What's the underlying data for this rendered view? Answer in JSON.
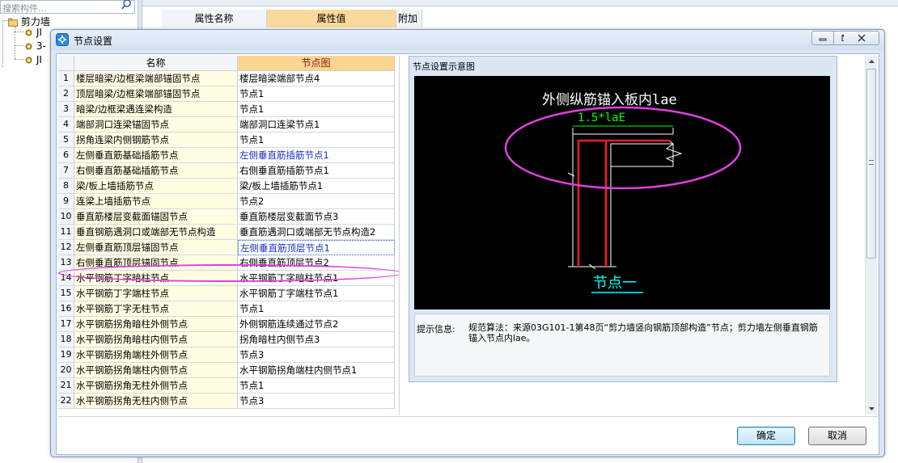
{
  "background": {
    "search_placeholder": "搜索构件...",
    "tree": {
      "root": "剪力墙",
      "children": [
        "JI",
        "3-",
        "JI"
      ]
    },
    "property_header": {
      "name_col": "属性名称",
      "value_col": "属性值",
      "extra_col": "附加"
    }
  },
  "dialog": {
    "title": "节点设置",
    "grid": {
      "headers": {
        "index": "",
        "name": "名称",
        "node": "节点图"
      },
      "rows": [
        {
          "idx": "1",
          "name": "楼层暗梁/边框梁端部锚固节点",
          "node": "楼层暗梁端部节点4"
        },
        {
          "idx": "2",
          "name": "顶层暗梁/边框梁端部锚固节点",
          "node": "节点1"
        },
        {
          "idx": "3",
          "name": "暗梁/边框梁遇连梁构造",
          "node": "节点1"
        },
        {
          "idx": "4",
          "name": "端部洞口连梁锚固节点",
          "node": "端部洞口连梁节点1"
        },
        {
          "idx": "5",
          "name": "拐角连梁内侧钢筋节点",
          "node": "节点1"
        },
        {
          "idx": "6",
          "name": "左侧垂直筋基础插筋节点",
          "node": "左侧垂直筋插筋节点1"
        },
        {
          "idx": "7",
          "name": "右侧垂直筋基础插筋节点",
          "node": "右侧垂直筋插筋节点1"
        },
        {
          "idx": "8",
          "name": "梁/板上墙插筋节点",
          "node": "梁/板上墙插筋节点1"
        },
        {
          "idx": "9",
          "name": "连梁上墙插筋节点",
          "node": "节点2"
        },
        {
          "idx": "10",
          "name": "垂直筋楼层变截面锚固节点",
          "node": "垂直筋楼层变截面节点3"
        },
        {
          "idx": "11",
          "name": "垂直钢筋遇洞口或端部无节点构造",
          "node": "垂直筋遇洞口或端部无节点构造2"
        },
        {
          "idx": "12",
          "name": "左侧垂直筋顶层锚固节点",
          "node": "左侧垂直筋顶层节点1"
        },
        {
          "idx": "13",
          "name": "右侧垂直筋顶层锚固节点",
          "node": "右侧垂直筋顶层节点2"
        },
        {
          "idx": "14",
          "name": "水平钢筋丁字暗柱节点",
          "node": "水平钢筋丁字暗柱节点1"
        },
        {
          "idx": "15",
          "name": "水平钢筋丁字端柱节点",
          "node": "水平钢筋丁字端柱节点1"
        },
        {
          "idx": "16",
          "name": "水平钢筋丁字无柱节点",
          "node": "节点1"
        },
        {
          "idx": "17",
          "name": "水平钢筋拐角暗柱外侧节点",
          "node": "外侧钢筋连续通过节点2"
        },
        {
          "idx": "18",
          "name": "水平钢筋拐角暗柱内侧节点",
          "node": "拐角暗柱内侧节点3"
        },
        {
          "idx": "19",
          "name": "水平钢筋拐角端柱外侧节点",
          "node": "节点3"
        },
        {
          "idx": "20",
          "name": "水平钢筋拐角端柱内侧节点",
          "node": "水平钢筋拐角端柱内侧节点1"
        },
        {
          "idx": "21",
          "name": "水平钢筋拐角无柱外侧节点",
          "node": "节点1"
        },
        {
          "idx": "22",
          "name": "水平钢筋拐角无柱内侧节点",
          "node": "节点3"
        }
      ]
    },
    "panel": {
      "title": "节点设置示意图",
      "diagram": {
        "main_label": "外侧纵筋锚入板内lae",
        "length_label": "1.5*laE",
        "node_label": "节点一"
      },
      "tip_label": "提示信息:",
      "tip_text": "规范算法：来源03G101-1第48页“剪力墙竖向钢筋顶部构造”节点；剪力墙左侧垂直钢筋锚入节点内lae。"
    },
    "buttons": {
      "ok": "确定",
      "cancel": "取消"
    }
  },
  "colors": {
    "highlight": "#e040e0",
    "header_accent": "#fad690",
    "selected_text": "#1a2fbf",
    "diagram_bg": "#000000",
    "rebar": "#ff0000",
    "dim_green": "#00ff00",
    "node_cyan": "#00ffff"
  },
  "icons": {
    "search": "search-icon",
    "tree_folder": "folder-icon",
    "tree_gear": "gear-icon",
    "title": "settings-icon",
    "minimize": "minimize-icon",
    "maximize": "maximize-icon",
    "close": "close-icon"
  }
}
